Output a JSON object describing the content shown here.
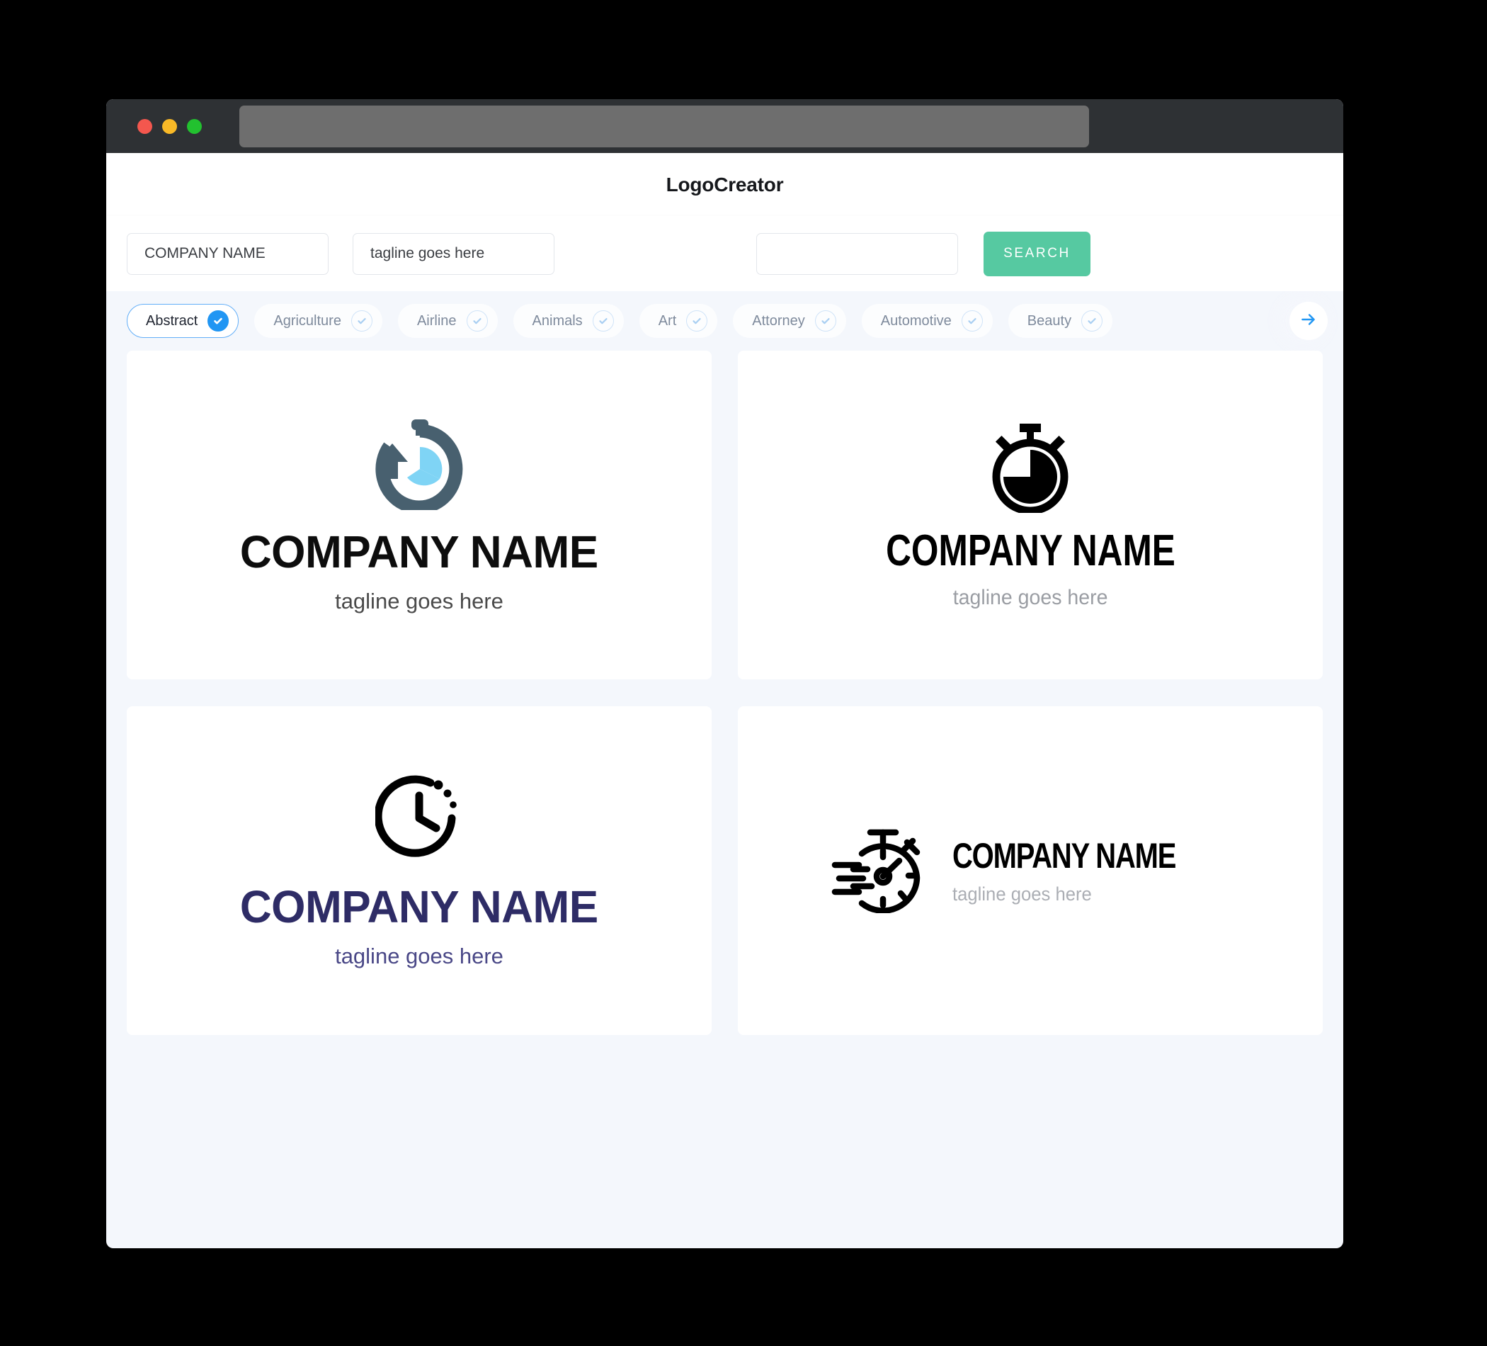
{
  "browser": {
    "traffic_lights": [
      "close",
      "minimize",
      "maximize"
    ],
    "url_value": "",
    "colors": {
      "titlebar": "#2E3134",
      "urlbar": "#6E6E6E",
      "red": "#F4574E",
      "yellow": "#F9B927",
      "green": "#22C12F"
    }
  },
  "app": {
    "title": "LogoCreator",
    "background": "#F4F7FC",
    "accent_green": "#56C9A1",
    "accent_blue": "#2196F3"
  },
  "search": {
    "company_value": "COMPANY NAME",
    "company_placeholder": "COMPANY NAME",
    "tagline_value": "tagline goes here",
    "tagline_placeholder": "tagline goes here",
    "extra_value": "",
    "extra_placeholder": "",
    "button_label": "SEARCH"
  },
  "categories": {
    "next_icon": "arrow-right-icon",
    "items": [
      {
        "label": "Abstract",
        "selected": true
      },
      {
        "label": "Agriculture",
        "selected": false
      },
      {
        "label": "Airline",
        "selected": false
      },
      {
        "label": "Animals",
        "selected": false
      },
      {
        "label": "Art",
        "selected": false
      },
      {
        "label": "Attorney",
        "selected": false
      },
      {
        "label": "Automotive",
        "selected": false
      },
      {
        "label": "Beauty",
        "selected": false
      }
    ]
  },
  "results": [
    {
      "icon": "stopwatch-arrow-icon",
      "name": "COMPANY NAME",
      "tagline": "tagline goes here",
      "name_color": "#0D0D0D",
      "tagline_color": "#4A4A4A",
      "icon_colors": {
        "ring": "#48606F",
        "wedge": "#7FD4F5"
      },
      "layout": "vertical"
    },
    {
      "icon": "stopwatch-solid-icon",
      "name": "COMPANY NAME",
      "tagline": "tagline goes here",
      "name_color": "#000000",
      "tagline_color": "#9A9DA3",
      "icon_colors": {
        "ring": "#000000",
        "wedge": "#000000"
      },
      "layout": "vertical"
    },
    {
      "icon": "clock-dots-icon",
      "name": "COMPANY NAME",
      "tagline": "tagline goes here",
      "name_color": "#2E2C66",
      "tagline_color": "#4A4887",
      "icon_colors": {
        "ring": "#000000",
        "wedge": "#000000"
      },
      "layout": "vertical"
    },
    {
      "icon": "stopwatch-speed-icon",
      "name": "COMPANY NAME",
      "tagline": "tagline goes here",
      "name_color": "#000000",
      "tagline_color": "#ABAEB4",
      "icon_colors": {
        "ring": "#000000",
        "wedge": "#000000"
      },
      "layout": "horizontal"
    }
  ]
}
